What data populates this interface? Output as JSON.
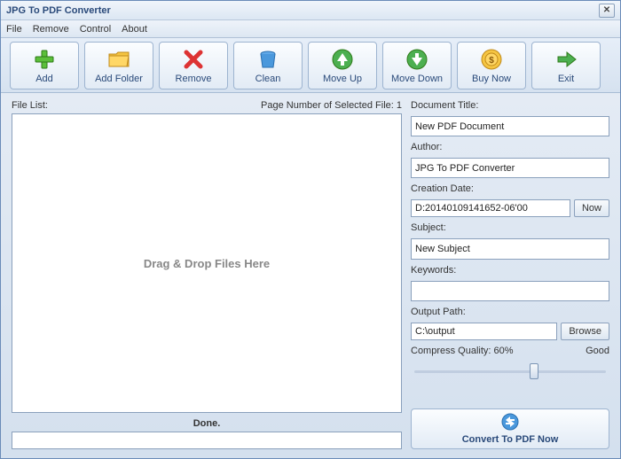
{
  "title": "JPG To PDF Converter",
  "menu": {
    "file": "File",
    "remove": "Remove",
    "control": "Control",
    "about": "About"
  },
  "toolbar": {
    "add": "Add",
    "addfolder": "Add Folder",
    "remove": "Remove",
    "clean": "Clean",
    "moveup": "Move Up",
    "movedown": "Move Down",
    "buynow": "Buy Now",
    "exit": "Exit"
  },
  "filelist": {
    "label": "File List:",
    "pageinfo": "Page Number of Selected File: 1",
    "placeholder": "Drag & Drop Files Here"
  },
  "status": "Done.",
  "fields": {
    "doctitle_label": "Document Title:",
    "doctitle": "New PDF Document",
    "author_label": "Author:",
    "author": "JPG To PDF Converter",
    "date_label": "Creation Date:",
    "date": "D:20140109141652-06'00",
    "now": "Now",
    "subject_label": "Subject:",
    "subject": "New Subject",
    "keywords_label": "Keywords:",
    "keywords": "",
    "output_label": "Output Path:",
    "output": "C:\\output",
    "browse": "Browse",
    "quality_label": "Compress Quality: 60%",
    "quality_text": "Good"
  },
  "convert": "Convert To PDF Now"
}
